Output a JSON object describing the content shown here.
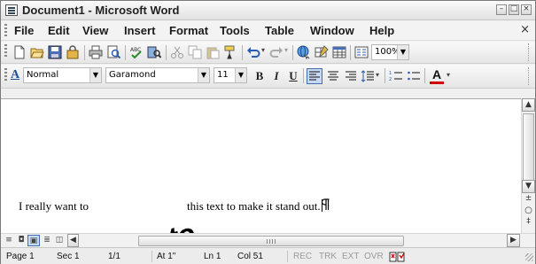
{
  "window": {
    "title": "Document1 - Microsoft Word"
  },
  "menu": {
    "items": [
      "File",
      "Edit",
      "View",
      "Insert",
      "Format",
      "Tools",
      "Table",
      "Window",
      "Help"
    ],
    "close": "×"
  },
  "standard_toolbar": {
    "zoom": "100%"
  },
  "formatting_toolbar": {
    "style_icon": "A",
    "style": "Normal",
    "font": "Garamond",
    "size": "11",
    "bold": "B",
    "italic": "I",
    "underline": "U",
    "font_color_icon": "A"
  },
  "document": {
    "text_before": "I really want to",
    "rotated_word": "rotate",
    "text_after": "this text to make it stand out."
  },
  "status": {
    "page": "Page 1",
    "section": "Sec 1",
    "pages": "1/1",
    "at": "At 1\"",
    "line": "Ln 1",
    "col": "Col 51",
    "rec": "REC",
    "trk": "TRK",
    "ext": "EXT",
    "ovr": "OVR"
  },
  "colors": {
    "accent": "#1f4e9c",
    "dim_status": "#9a9a9a"
  }
}
